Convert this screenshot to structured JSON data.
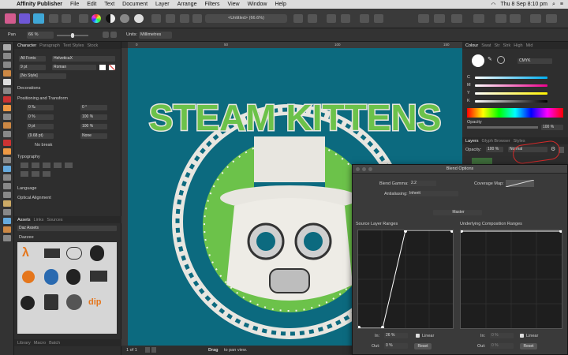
{
  "menubar": {
    "app_name": "Affinity Publisher",
    "items": [
      "File",
      "Edit",
      "Text",
      "Document",
      "Layer",
      "Arrange",
      "Filters",
      "View",
      "Window",
      "Help"
    ],
    "clock": "Thu 8 Sep  8:10 pm"
  },
  "toolbar": {
    "doc_title": "<Untitled> (66.6%)"
  },
  "contextbar": {
    "pan_label": "Pan",
    "zoom_value": "66 %",
    "units_label": "Units:",
    "units_value": "Millimetres"
  },
  "character_panel": {
    "tabs": [
      "Character",
      "Paragraph",
      "Text Styles",
      "Stock"
    ],
    "font_collection": "All Fonts",
    "font_family": "HelveticaX",
    "font_size": "9 pt",
    "font_style": "Roman",
    "style": "[No Style]",
    "sections": {
      "decorations": "Decorations",
      "positioning": "Positioning and Transform",
      "typography": "Typography",
      "language": "Language",
      "optical": "Optical Alignment"
    },
    "fields": [
      "0 ‰",
      "0 °",
      "0 %",
      "100 %",
      "0 pt",
      "100 %",
      "(9.68 pt)",
      "None"
    ],
    "no_break": "No break"
  },
  "assets_panel": {
    "tabs": [
      "Assets",
      "Links",
      "Sources"
    ],
    "category": "Daz Assets",
    "group": "Dazzee",
    "bottom_tabs": [
      "Library",
      "Macro",
      "Batch"
    ]
  },
  "status": {
    "page": "1 of 1",
    "hint_bold": "Drag",
    "hint": "to pan view."
  },
  "ruler": {
    "ticks": [
      "0",
      "50",
      "100",
      "150"
    ]
  },
  "artwork": {
    "title": "STEAM KITTENS"
  },
  "colour_panel": {
    "tabs": [
      "Colour",
      "Swat",
      "Str",
      "Strk",
      "High",
      "Mid"
    ],
    "model": "CMYK",
    "channels": [
      "C",
      "M",
      "Y",
      "K"
    ],
    "opacity_label": "Opacity",
    "opacity_value": "100 %"
  },
  "layers_panel": {
    "tabs": [
      "Layers",
      "Glyph Browser",
      "Styles"
    ],
    "opacity_label": "Opacity:",
    "opacity_value": "100 %",
    "blend_mode": "Normal"
  },
  "blend_options": {
    "title": "Blend Options",
    "gamma_label": "Blend Gamma:",
    "gamma_value": "2.2",
    "antialias_label": "Antialiasing:",
    "antialias_value": "Inherit",
    "coverage_label": "Coverage Map:",
    "channel": "Master",
    "source_label": "Source Layer Ranges",
    "underlying_label": "Underlying Composition Ranges",
    "in_label": "In:",
    "out_label": "Out:",
    "src_in": "26 %",
    "src_out": "0 %",
    "und_in": "0 %",
    "und_out": "0 %",
    "linear_label": "Linear",
    "reset_label": "Reset"
  },
  "colors": {
    "canvas_bg": "#0c6a7f",
    "accent_green": "#6cc24a",
    "annotation_red": "#d42a2a"
  }
}
